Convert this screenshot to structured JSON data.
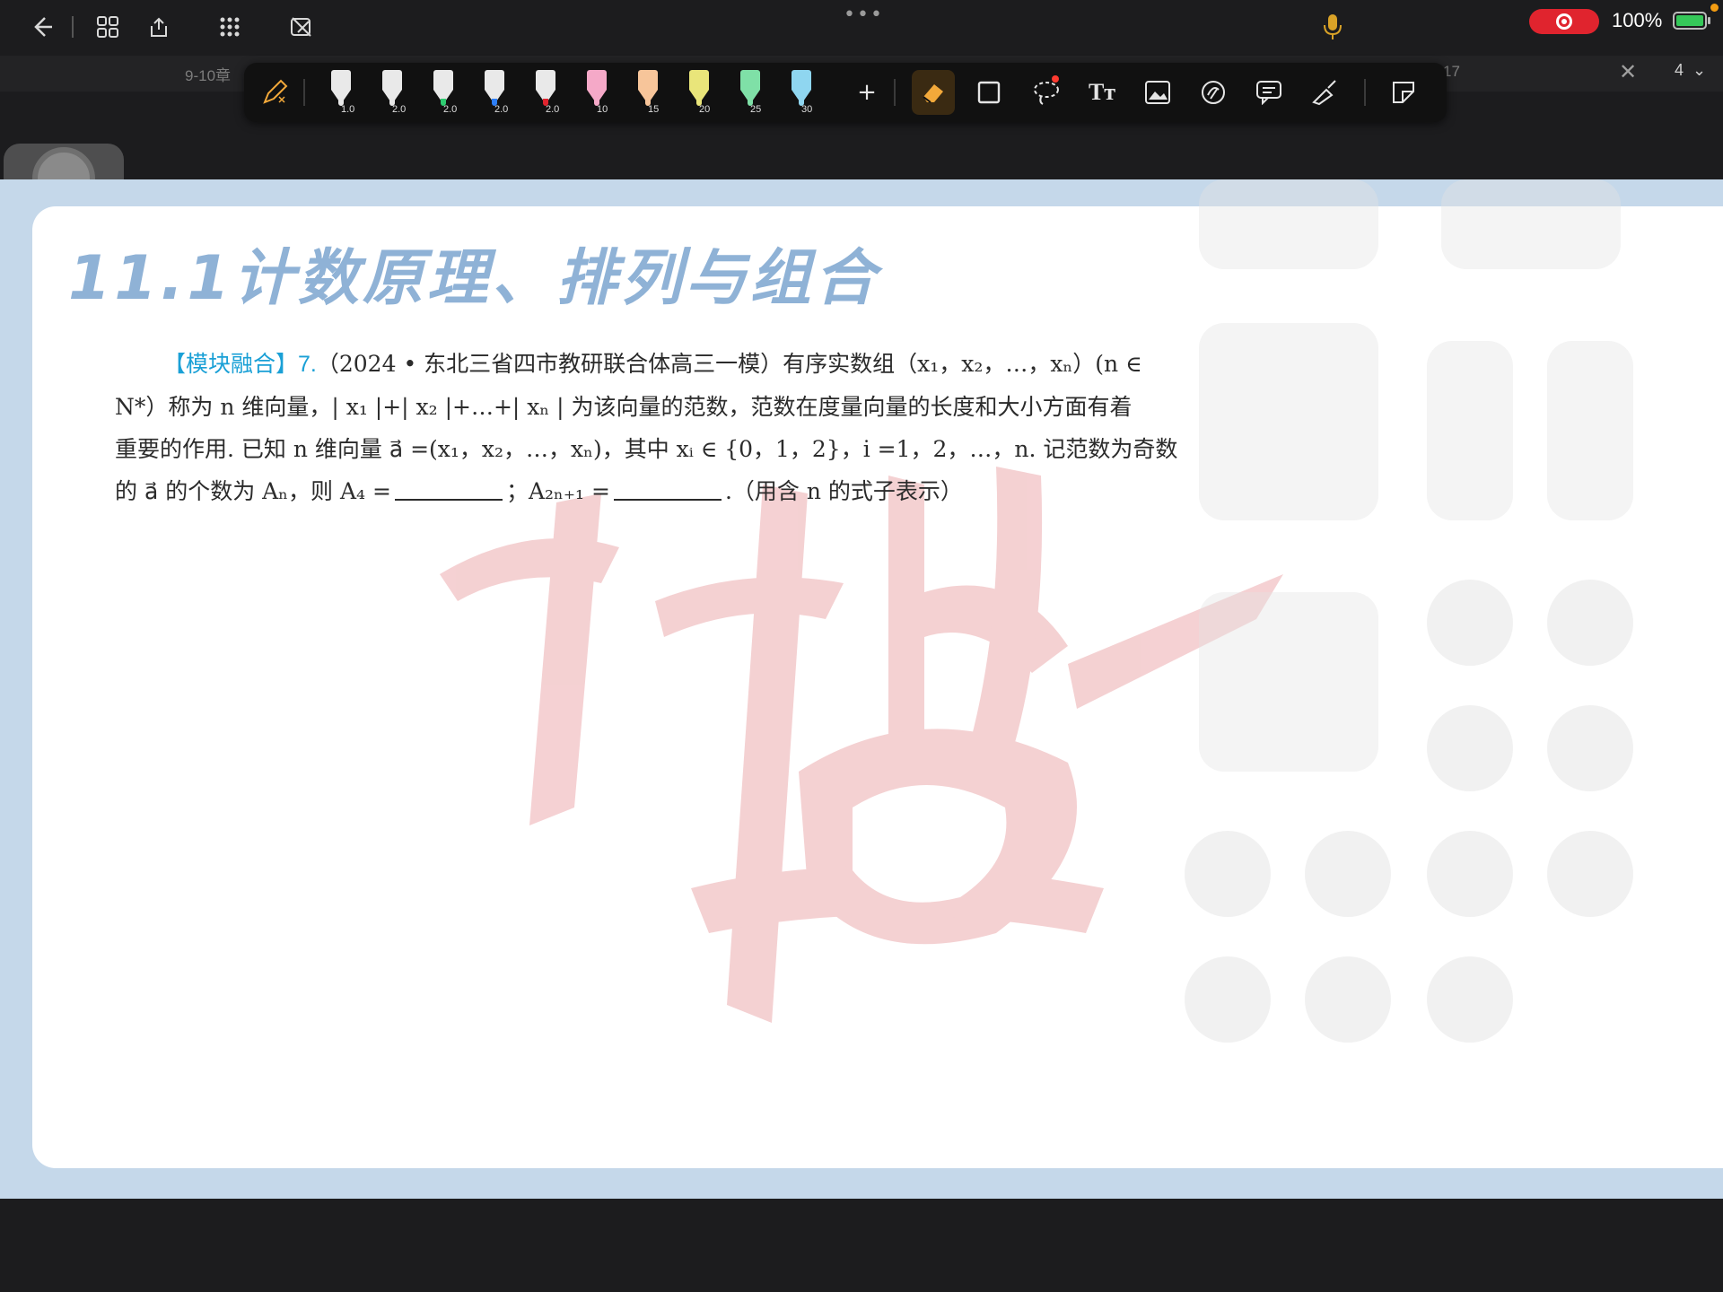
{
  "topbar": {
    "back_icon": "arrow-left-icon",
    "more_dots": "•••",
    "battery_percent": "100%",
    "battery_level": 1.0,
    "recording_active": true
  },
  "tabs": {
    "left_label": "9-10章",
    "right_label": "17",
    "page_number": "4"
  },
  "pen_toolbar": {
    "pens": [
      {
        "size": "1.0",
        "color": "#e8e8e8"
      },
      {
        "size": "2.0",
        "color": "#e8e8e8"
      },
      {
        "size": "2.0",
        "color": "#2ecc71"
      },
      {
        "size": "2.0",
        "color": "#2d7ff9"
      },
      {
        "size": "2.0",
        "color": "#e0242e"
      },
      {
        "size": "10",
        "color": "#f5a9c8"
      },
      {
        "size": "15",
        "color": "#f7c59a"
      },
      {
        "size": "20",
        "color": "#e9e57a"
      },
      {
        "size": "25",
        "color": "#7fe0a7"
      },
      {
        "size": "30",
        "color": "#8fd6f0"
      }
    ],
    "add_label": "+",
    "text_tool_label": "Tт",
    "accent": "#f3a93a"
  },
  "document": {
    "chapter_title": "11.1计数原理、排列与组合",
    "problem": {
      "tag": "【模块融合】",
      "number": "7.",
      "line1": "（2024 • 东北三省四市教研联合体高三一模）有序实数组（x₁，x₂，…，xₙ）(n ∈",
      "line2": "N*）称为 n 维向量，| x₁ |+| x₂ |+…+| xₙ | 为该向量的范数，范数在度量向量的长度和大小方面有着",
      "line3": "重要的作用. 已知 n 维向量 a⃗ =(x₁，x₂，…，xₙ)，其中 xᵢ ∈ {0，1，2}，i =1，2，…，n. 记范数为奇数",
      "line4_a": "的 a⃗ 的个数为 Aₙ，则 A₄ =",
      "line4_b": "；A₂ₙ₊₁ =",
      "line4_c": ".（用含 n 的式子表示）"
    }
  },
  "colors": {
    "title_blue": "#8fb2d6",
    "tag_blue": "#1aa0d6",
    "frame_blue": "#c5d8ea",
    "watermark_red": "#f3c9cb"
  }
}
